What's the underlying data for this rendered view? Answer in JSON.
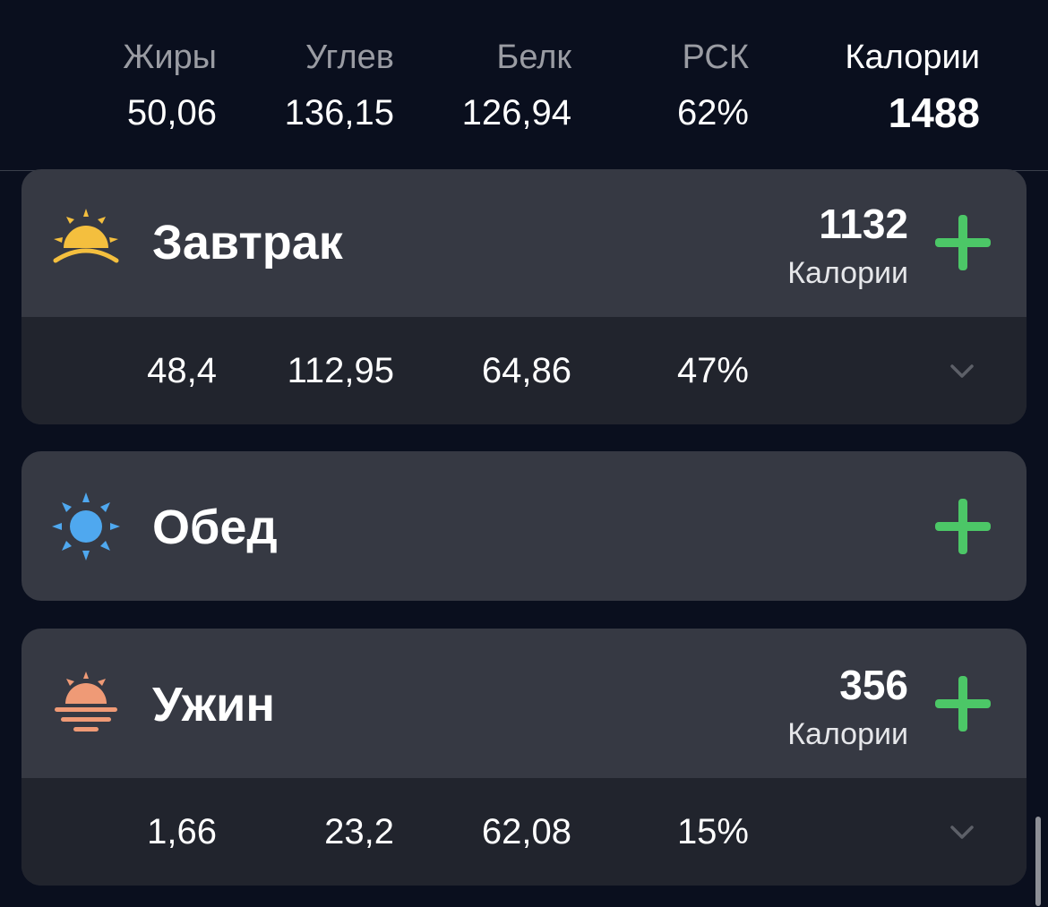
{
  "summary": {
    "fat": {
      "label": "Жиры",
      "value": "50,06"
    },
    "carbs": {
      "label": "Углев",
      "value": "136,15"
    },
    "protein": {
      "label": "Белк",
      "value": "126,94"
    },
    "rsk": {
      "label": "РСК",
      "value": "62%"
    },
    "calories": {
      "label": "Калории",
      "value": "1488"
    }
  },
  "meals": {
    "breakfast": {
      "title": "Завтрак",
      "icon": "sunrise-icon",
      "calories": "1132",
      "calories_label": "Калории",
      "fat": "48,4",
      "carbs": "112,95",
      "protein": "64,86",
      "rsk": "47%"
    },
    "lunch": {
      "title": "Обед",
      "icon": "sun-icon"
    },
    "dinner": {
      "title": "Ужин",
      "icon": "sunset-icon",
      "calories": "356",
      "calories_label": "Калории",
      "fat": "1,66",
      "carbs": "23,2",
      "protein": "62,08",
      "rsk": "15%"
    }
  },
  "colors": {
    "background": "#0a0f1e",
    "card": "#363943",
    "card_footer": "#21242d",
    "accent_green": "#4cc767",
    "sunrise_yellow": "#f4bf3e",
    "sun_blue": "#4fa8ef",
    "sunset_salmon": "#ef9a76"
  }
}
